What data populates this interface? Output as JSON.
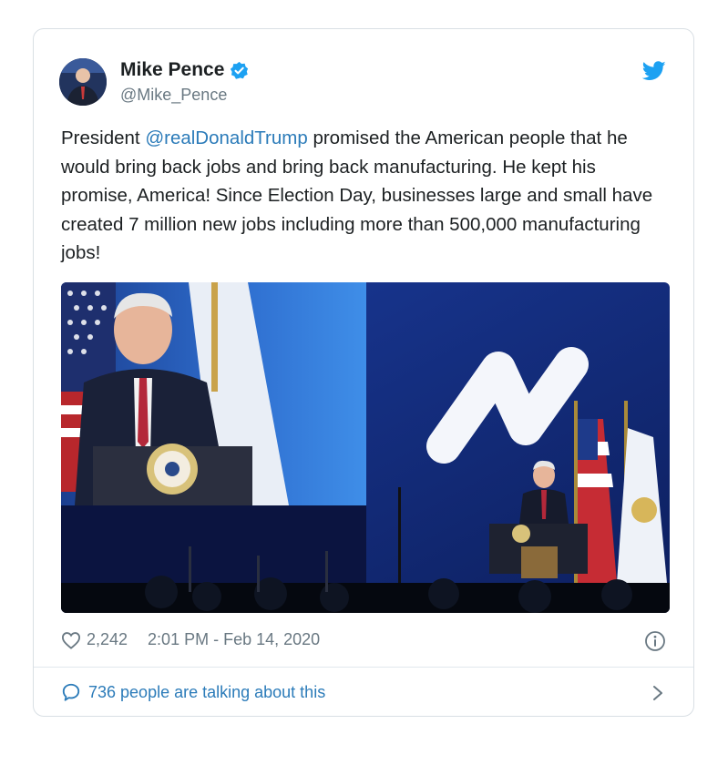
{
  "tweet": {
    "author_name": "Mike Pence",
    "author_handle": "@Mike_Pence",
    "text_before": "President ",
    "mention": "@realDonaldTrump",
    "text_after": " promised the American people that he would bring back jobs and bring back manufacturing. He kept his promise, America! Since Election Day, businesses large and small have created 7 million new jobs including more than 500,000 manufacturing jobs!",
    "likes": "2,242",
    "timestamp": "2:01 PM - Feb 14, 2020",
    "talking": "736 people are talking about this"
  },
  "icons": {
    "verified": "verified-badge-icon",
    "brand": "twitter-bird-icon",
    "like": "heart-icon",
    "info": "info-icon",
    "reply": "speech-bubble-icon",
    "more": "chevron-right-icon"
  },
  "colors": {
    "link": "#2b7bb9",
    "brand": "#1da1f2",
    "muted": "#697882",
    "text": "#1c2022"
  }
}
